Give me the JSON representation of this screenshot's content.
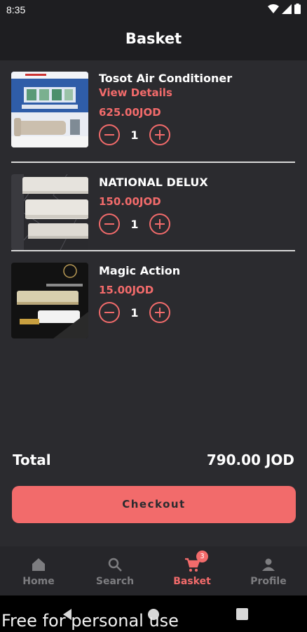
{
  "status_bar": {
    "time": "8:35"
  },
  "app_bar": {
    "title": "Basket"
  },
  "items": [
    {
      "name": "Tosot Air Conditioner",
      "link": "View Details",
      "price": "625.00JOD",
      "quantity": "1"
    },
    {
      "name": "NATIONAL DELUX",
      "price": "150.00JOD",
      "quantity": "1"
    },
    {
      "name": "Magic Action",
      "price": "15.00JOD",
      "quantity": "1"
    }
  ],
  "total": {
    "label": "Total",
    "value": "790.00 JOD"
  },
  "checkout": {
    "label": "Checkout"
  },
  "nav": {
    "items": [
      {
        "label": "Home",
        "icon": "home-icon"
      },
      {
        "label": "Search",
        "icon": "search-icon"
      },
      {
        "label": "Basket",
        "icon": "cart-icon",
        "badge": "3"
      },
      {
        "label": "Profile",
        "icon": "person-icon"
      }
    ],
    "active": "Basket"
  },
  "watermark": "Free for personal use",
  "colors": {
    "background": "#2b2b2f",
    "bar": "#1e1e21",
    "accent": "#f26b6b",
    "inactive": "#7d7d80"
  }
}
